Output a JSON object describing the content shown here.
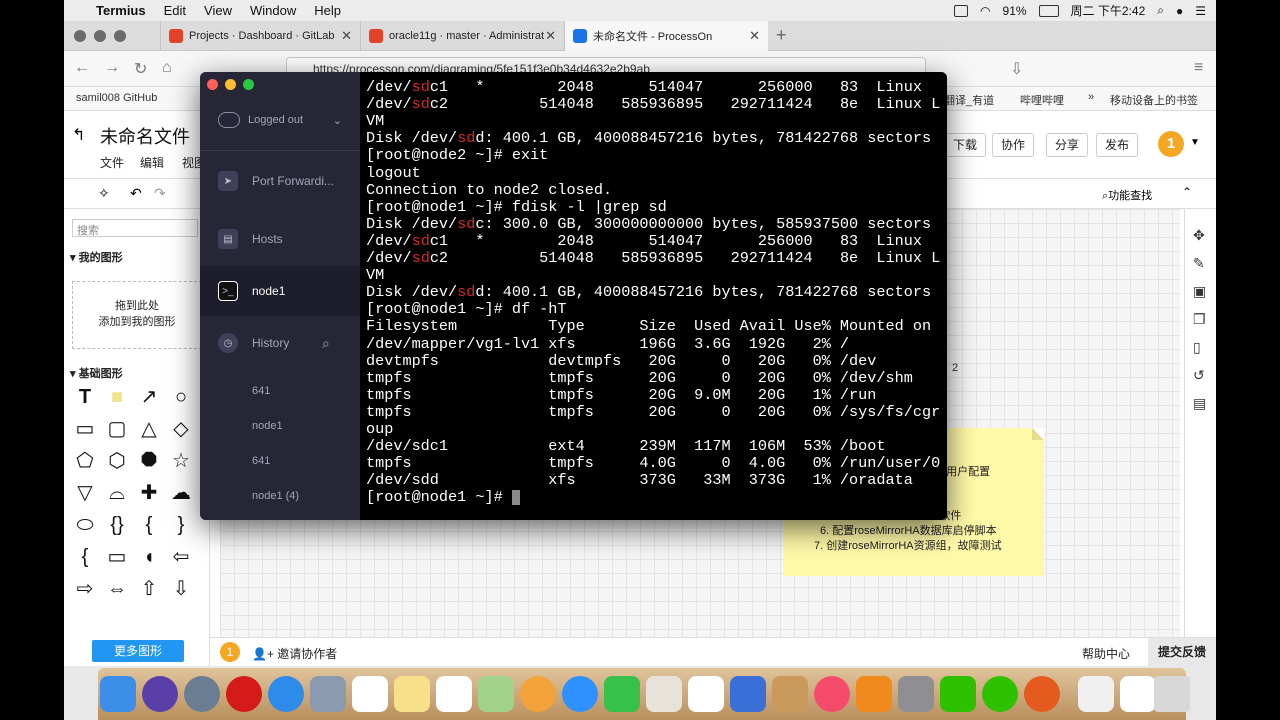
{
  "menubar": {
    "app": "Termius",
    "items": [
      "Edit",
      "View",
      "Window",
      "Help"
    ],
    "battery": "91%",
    "clock": "周二 下午2:42"
  },
  "browser": {
    "tabs": [
      {
        "title": "Projects · Dashboard · GitLab"
      },
      {
        "title": "oracle11g · master · Administrat"
      },
      {
        "title": "未命名文件 - ProcessOn"
      }
    ],
    "url": "https://processon.com/diagraming/5fe151f3e0b34d4632e2b9ab",
    "bookmarks": {
      "left": "samil008 GitHub",
      "r1": "翻译_有道",
      "r2": "哔哩哔哩",
      "r3": "移动设备上的书签"
    }
  },
  "processon": {
    "title": "未命名文件",
    "menus": [
      "文件",
      "编辑",
      "视图"
    ],
    "buttons": {
      "download": "下载",
      "collab": "协作",
      "share": "分享",
      "publish": "发布",
      "badge": "1"
    },
    "find": "功能查找",
    "search_placeholder": "搜索",
    "my_shapes": "我的图形",
    "drop_line1": "拖到此处",
    "drop_line2": "添加到我的图形",
    "basic_shapes": "基础图形",
    "more_shapes": "更多图形",
    "invite": "邀请协作者",
    "invite_badge": "1",
    "help": "帮助中心",
    "feedback": "提交反馈",
    "note_lines": [
      "acle用户配置",
      "件",
      "A软件",
      "6. 配置roseMirrorHA数据库启停脚本",
      "7. 创建roseMirrorHA资源组，故障测试"
    ],
    "canvas_fragment": "2"
  },
  "termius": {
    "status": "Logged out",
    "nav": [
      {
        "label": "Port Forwardi..."
      },
      {
        "label": "Hosts"
      },
      {
        "label": "node1"
      },
      {
        "label": "History"
      }
    ],
    "history": [
      "641",
      "node1",
      "641",
      "node1 (4)"
    ]
  },
  "terminal": {
    "lines": [
      [
        "/dev/",
        "sd",
        "c1   *        2048      514047      256000   83  Linux"
      ],
      [
        "/dev/",
        "sd",
        "c2          514048   585936895   292711424   8e  Linux L"
      ],
      [
        "VM",
        "",
        ""
      ],
      [
        "Disk /dev/",
        "sd",
        "d: 400.1 GB, 400088457216 bytes, 781422768 sectors"
      ],
      [
        "[root@node2 ~]# exit",
        "",
        ""
      ],
      [
        "logout",
        "",
        ""
      ],
      [
        "Connection to node2 closed.",
        "",
        ""
      ],
      [
        "[root@node1 ~]# fdisk -l |grep sd",
        "",
        ""
      ],
      [
        "Disk /dev/",
        "sd",
        "c: 300.0 GB, 300000000000 bytes, 585937500 sectors"
      ],
      [
        "/dev/",
        "sd",
        "c1   *        2048      514047      256000   83  Linux"
      ],
      [
        "/dev/",
        "sd",
        "c2          514048   585936895   292711424   8e  Linux L"
      ],
      [
        "VM",
        "",
        ""
      ],
      [
        "Disk /dev/",
        "sd",
        "d: 400.1 GB, 400088457216 bytes, 781422768 sectors"
      ],
      [
        "[root@node1 ~]# df -hT",
        "",
        ""
      ],
      [
        "Filesystem          Type      Size  Used Avail Use% Mounted on",
        "",
        ""
      ],
      [
        "/dev/mapper/vg1-lv1 xfs       196G  3.6G  192G   2% /",
        "",
        ""
      ],
      [
        "devtmpfs            devtmpfs   20G     0   20G   0% /dev",
        "",
        ""
      ],
      [
        "tmpfs               tmpfs      20G     0   20G   0% /dev/shm",
        "",
        ""
      ],
      [
        "tmpfs               tmpfs      20G  9.0M   20G   1% /run",
        "",
        ""
      ],
      [
        "tmpfs               tmpfs      20G     0   20G   0% /sys/fs/cgr",
        "",
        ""
      ],
      [
        "oup",
        "",
        ""
      ],
      [
        "/dev/sdc1           ext4      239M  117M  106M  53% /boot",
        "",
        ""
      ],
      [
        "tmpfs               tmpfs     4.0G     0  4.0G   0% /run/user/0",
        "",
        ""
      ],
      [
        "/dev/sdd            xfs       373G   33M  373G   1% /oradata",
        "",
        ""
      ],
      [
        "[root@node1 ~]# ",
        "",
        ""
      ]
    ]
  }
}
